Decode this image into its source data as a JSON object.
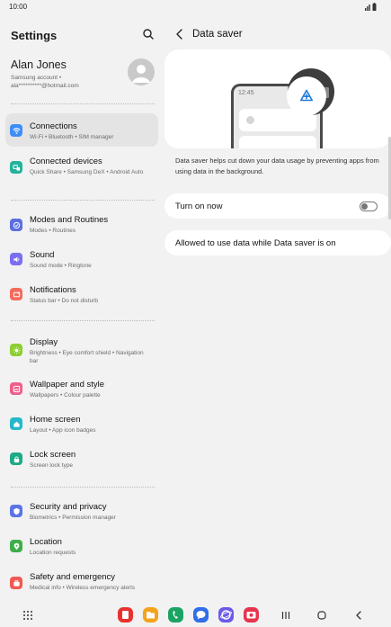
{
  "status_bar": {
    "time": "10:00"
  },
  "settings": {
    "title": "Settings",
    "profile": {
      "name": "Alan Jones",
      "account_line": "Samsung account •",
      "email": "ala**********@hotmail.com"
    },
    "items": [
      {
        "title": "Connections",
        "subtitle": "Wi-Fi • Bluetooth • SIM manager",
        "color": "#3e8ef7",
        "icon": "wifi-icon"
      },
      {
        "title": "Connected devices",
        "subtitle": "Quick Share • Samsung DeX • Android Auto",
        "color": "#23b39a",
        "icon": "connected-devices-icon"
      },
      {
        "title": "Modes and Routines",
        "subtitle": "Modes • Routines",
        "color": "#5a6fe0",
        "icon": "modes-check-icon"
      },
      {
        "title": "Sound",
        "subtitle": "Sound mode • Ringtone",
        "color": "#7b6ff0",
        "icon": "speaker-icon"
      },
      {
        "title": "Notifications",
        "subtitle": "Status bar • Do not disturb",
        "color": "#f46b5e",
        "icon": "notification-icon"
      },
      {
        "title": "Display",
        "subtitle": "Brightness • Eye comfort shield • Navigation bar",
        "color": "#8ccf2f",
        "icon": "sun-icon"
      },
      {
        "title": "Wallpaper and style",
        "subtitle": "Wallpapers • Colour palette",
        "color": "#ee5f8a",
        "icon": "wallpaper-icon"
      },
      {
        "title": "Home screen",
        "subtitle": "Layout • App icon badges",
        "color": "#26b8c9",
        "icon": "home-icon"
      },
      {
        "title": "Lock screen",
        "subtitle": "Screen lock type",
        "color": "#1faa86",
        "icon": "lock-icon"
      },
      {
        "title": "Security and privacy",
        "subtitle": "Biometrics • Permission manager",
        "color": "#5a74e6",
        "icon": "shield-icon"
      },
      {
        "title": "Location",
        "subtitle": "Location requests",
        "color": "#3fae4a",
        "icon": "location-pin-icon"
      },
      {
        "title": "Safety and emergency",
        "subtitle": "Medical info • Wireless emergency alerts",
        "color": "#ef5a52",
        "icon": "emergency-icon"
      }
    ]
  },
  "data_saver": {
    "title": "Data saver",
    "illustration_time": "12:45",
    "description": "Data saver helps cut down your data usage by preventing apps from using data in the background.",
    "toggle_label": "Turn on now",
    "toggle_on": false,
    "allowed_label": "Allowed to use data while Data saver is on"
  },
  "dock": {
    "apps": [
      {
        "name": "flipboard-app-icon",
        "color": "#e8322f"
      },
      {
        "name": "my-files-app-icon",
        "color": "#f4a31b"
      },
      {
        "name": "phone-app-icon",
        "color": "#1aa463"
      },
      {
        "name": "messages-app-icon",
        "color": "#2f6ee8"
      },
      {
        "name": "internet-app-icon",
        "color": "#6b5ae8"
      },
      {
        "name": "camera-app-icon",
        "color": "#e8344f"
      }
    ]
  }
}
